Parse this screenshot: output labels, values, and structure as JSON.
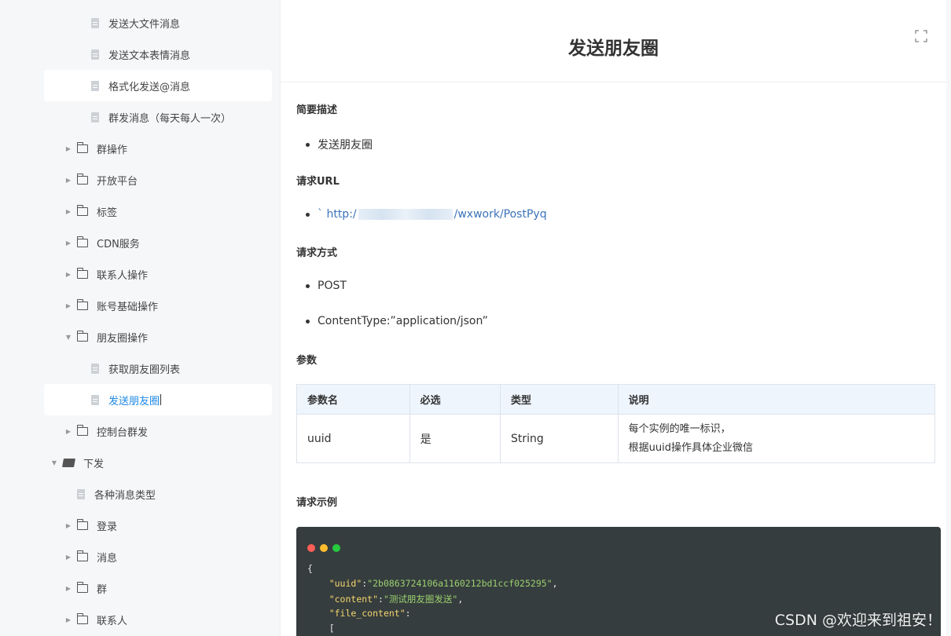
{
  "sidebar": {
    "items": [
      {
        "label": "发送大文件消息",
        "type": "doc"
      },
      {
        "label": "发送文本表情消息",
        "type": "doc"
      },
      {
        "label": "格式化发送@消息",
        "type": "doc"
      },
      {
        "label": "群发消息（每天每人一次）",
        "type": "doc"
      },
      {
        "label": "群操作",
        "type": "folder"
      },
      {
        "label": "开放平台",
        "type": "folder"
      },
      {
        "label": "标签",
        "type": "folder"
      },
      {
        "label": "CDN服务",
        "type": "folder"
      },
      {
        "label": "联系人操作",
        "type": "folder"
      },
      {
        "label": "账号基础操作",
        "type": "folder"
      },
      {
        "label": "朋友圈操作",
        "type": "folder-expanded"
      },
      {
        "label": "获取朋友圈列表",
        "type": "doc"
      },
      {
        "label": "发送朋友圈",
        "type": "doc-active"
      },
      {
        "label": "控制台群发",
        "type": "folder"
      },
      {
        "label": "下发",
        "type": "folder-open"
      },
      {
        "label": "各种消息类型",
        "type": "doc"
      },
      {
        "label": "登录",
        "type": "folder"
      },
      {
        "label": "消息",
        "type": "folder"
      },
      {
        "label": "群",
        "type": "folder"
      },
      {
        "label": "联系人",
        "type": "folder"
      }
    ]
  },
  "page": {
    "title": "发送朋友圈",
    "sections": {
      "summary_heading": "简要描述",
      "summary_item": "发送朋友圈",
      "url_heading": "请求URL",
      "url_prefix": "` http:/",
      "url_suffix": "/wxwork/PostPyq",
      "method_heading": "请求方式",
      "method_item1": "POST",
      "method_item2": "ContentType:”application/json”",
      "params_heading": "参数",
      "example_heading": "请求示例"
    },
    "table": {
      "headers": [
        "参数名",
        "必选",
        "类型",
        "说明"
      ],
      "rows": [
        {
          "name": "uuid",
          "required": "是",
          "type": "String",
          "desc_line1": "每个实例的唯一标识，",
          "desc_line2": "根据uuid操作具体企业微信"
        }
      ]
    },
    "code": {
      "line1": "{",
      "line2_key": "\"uuid\"",
      "line2_val": "\"2b0863724106a1160212bd1ccf025295\"",
      "line3_key": "\"content\"",
      "line3_val": "\"测试朋友圈发送\"",
      "line4_key": "\"file_content\"",
      "line5": "["
    }
  },
  "watermark": "CSDN @欢迎来到祖安！",
  "colors": {
    "link": "#3b73b9",
    "active": "#1e88e5",
    "code_bg": "#363d3e",
    "table_header_bg": "#eef5fd"
  }
}
